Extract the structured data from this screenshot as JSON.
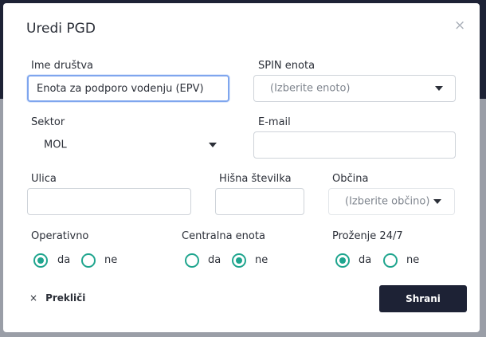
{
  "modal": {
    "title": "Uredi PGD",
    "close_glyph": "×"
  },
  "form": {
    "name": {
      "label": "Ime društva",
      "value": "Enota za podporo vodenju (EPV)"
    },
    "spin": {
      "label": "SPIN enota",
      "placeholder": "(Izberite enoto)"
    },
    "sector": {
      "label": "Sektor",
      "value": "MOL"
    },
    "email": {
      "label": "E-mail",
      "value": ""
    },
    "street": {
      "label": "Ulica",
      "value": ""
    },
    "house_number": {
      "label": "Hišna številka",
      "value": ""
    },
    "municipality": {
      "label": "Občina",
      "placeholder": "(Izberite občino)"
    },
    "operativno": {
      "label": "Operativno",
      "selected": "da",
      "options": [
        "da",
        "ne"
      ]
    },
    "centralna": {
      "label": "Centralna enota",
      "selected": "ne",
      "options": [
        "da",
        "ne"
      ]
    },
    "prozenje": {
      "label": "Proženje 24/7",
      "selected": "da",
      "options": [
        "da",
        "ne"
      ]
    }
  },
  "footer": {
    "cancel_icon": "×",
    "cancel_label": "Prekliči",
    "save_label": "Shrani"
  },
  "colors": {
    "accent": "#1fa58e",
    "primary_button": "#1d2235",
    "focus_border": "#7fa6ee"
  },
  "icons": [
    "close-icon",
    "chevron-down-icon",
    "cancel-x-icon"
  ]
}
